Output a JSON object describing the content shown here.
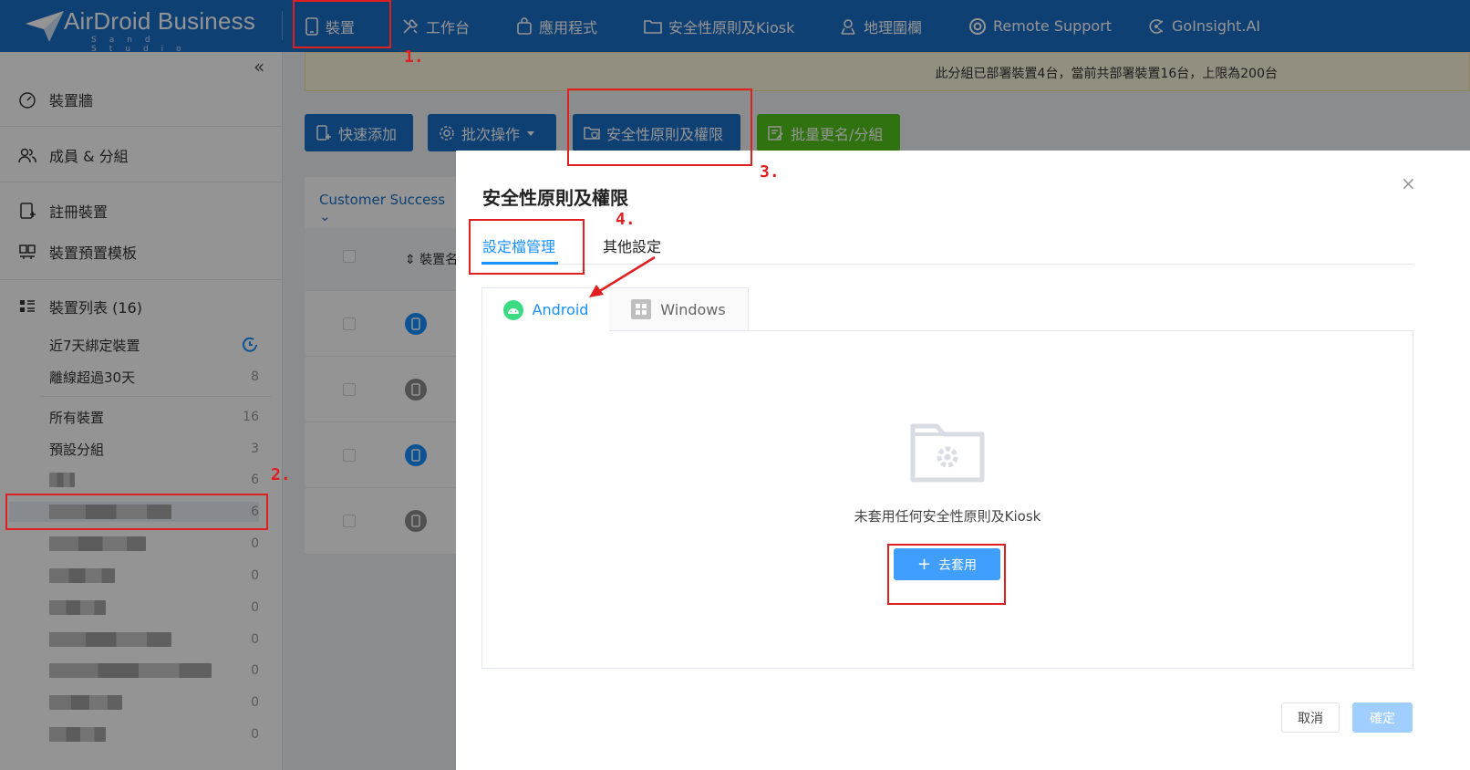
{
  "topbar": {
    "logo_text": "AirDroid Business",
    "logo_sub": "Sand Studio",
    "nav": [
      {
        "label": "裝置",
        "icon": "phone-icon"
      },
      {
        "label": "工作台",
        "icon": "tools-icon"
      },
      {
        "label": "應用程式",
        "icon": "bag-icon"
      },
      {
        "label": "安全性原則及Kiosk",
        "icon": "folder-icon"
      },
      {
        "label": "地理圍欄",
        "icon": "geofence-icon"
      },
      {
        "label": "Remote Support",
        "icon": "lifebuoy-icon"
      },
      {
        "label": "GoInsight.AI",
        "icon": "ai-icon"
      }
    ]
  },
  "sidebar": {
    "collapse": "«",
    "main": [
      {
        "label": "裝置牆",
        "icon": "dashboard-icon"
      },
      {
        "label": "成員 & 分組",
        "icon": "users-icon"
      },
      {
        "label": "註冊裝置",
        "icon": "register-device-icon"
      },
      {
        "label": "裝置預置模板",
        "icon": "template-icon"
      },
      {
        "label": "裝置列表 (16)",
        "icon": "list-icon"
      }
    ],
    "sub": [
      {
        "label": "近7天綁定裝置",
        "count": ""
      },
      {
        "label": "離線超過30天",
        "count": "8"
      },
      {
        "label": "所有裝置",
        "count": "16"
      },
      {
        "label": "預設分組",
        "count": "3"
      }
    ],
    "blurred_counts": [
      "6",
      "6",
      "0",
      "0",
      "0",
      "0",
      "0",
      "0",
      "0"
    ]
  },
  "main": {
    "notice": "此分組已部署裝置4台，當前共部署裝置16台，上限為200台",
    "buttons": {
      "quick_add": "快速添加",
      "batch_ops": "批次操作",
      "security": "安全性原則及權限",
      "batch_rename": "批量更名/分組"
    },
    "group_dropdown": "Customer Success",
    "col_header": "裝置名"
  },
  "dialog": {
    "title": "安全性原則及權限",
    "close": "×",
    "tabs": [
      "設定檔管理",
      "其他設定"
    ],
    "platforms": [
      "Android",
      "Windows"
    ],
    "empty_text": "未套用任何安全性原則及Kiosk",
    "apply_label": "去套用",
    "apply_plus": "+",
    "cancel": "取消",
    "confirm": "確定"
  },
  "annotations": [
    "1.",
    "2.",
    "3.",
    "4."
  ],
  "colors": {
    "brand_blue": "#1b6fc8",
    "accent_blue": "#1890ff",
    "annotation_red": "#e02020",
    "green_button": "#52c41a"
  }
}
